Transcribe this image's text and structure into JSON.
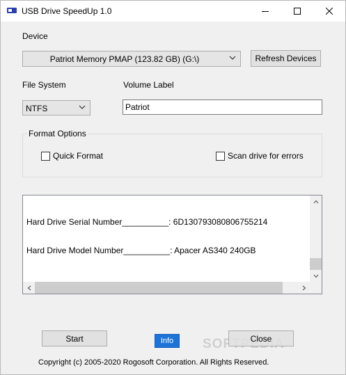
{
  "window": {
    "title": "USB Drive SpeedUp 1.0",
    "icons": [
      "usb-drive-app-icon",
      "minimize-icon",
      "maximize-icon",
      "close-icon"
    ]
  },
  "device": {
    "label": "Device",
    "selected": "Patriot Memory PMAP (123.82 GB) (G:\\)",
    "refresh_label": "Refresh Devices"
  },
  "file_system": {
    "label": "File System",
    "selected": "NTFS"
  },
  "volume_label": {
    "label": "Volume Label",
    "value": "Patriot"
  },
  "format_options": {
    "legend": "Format Options",
    "quick_format": {
      "label": "Quick Format",
      "checked": false
    },
    "scan_errors": {
      "label": "Scan drive for errors",
      "checked": false
    }
  },
  "info_lines": [
    "Hard Drive Serial Number__________: 6D130793080806755214",
    "Hard Drive Model Number__________: Apacer AS340 240GB"
  ],
  "buttons": {
    "start": "Start",
    "info": "Info",
    "close": "Close"
  },
  "watermark": "SOFTPEDIA",
  "copyright": "Copyright (c) 2005-2020 Rogosoft Corporation. All Rights Reserved.",
  "colors": {
    "window_bg": "#f0f0f0",
    "info_button": "#1e73d8",
    "titlebar": "#ffffff"
  }
}
